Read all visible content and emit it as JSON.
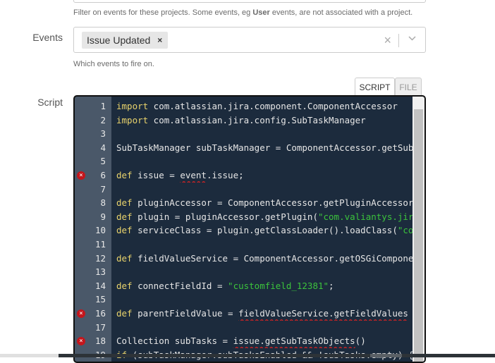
{
  "projects": {
    "help": "Filter on events for these projects. Some events, eg ",
    "help_bold": "User",
    "help_tail": " events, are not associated with a project."
  },
  "events": {
    "label": "Events",
    "selected": [
      {
        "label": "Issue Updated",
        "remove": "×"
      }
    ],
    "clear": "×",
    "chevron": "⌵",
    "help": "Which events to fire on."
  },
  "script": {
    "label": "Script",
    "tabs": [
      {
        "label": "SCRIPT",
        "active": true
      },
      {
        "label": "FILE",
        "active": false
      }
    ],
    "lines": [
      {
        "n": "1",
        "kw": "import",
        "rest": " com.atlassian.jira.component.ComponentAccessor"
      },
      {
        "n": "2",
        "kw": "import",
        "rest": " com.atlassian.jira.config.SubTaskManager"
      },
      {
        "n": "3",
        "rest": ""
      },
      {
        "n": "4",
        "rest": "SubTaskManager subTaskManager = ComponentAccessor.getSubTaskManager()"
      },
      {
        "n": "5",
        "rest": ""
      },
      {
        "n": "6",
        "kw": "def",
        "pre": " issue = ",
        "err": "event",
        "rest": ".issue;",
        "error": true
      },
      {
        "n": "7",
        "rest": ""
      },
      {
        "n": "8",
        "kw": "def",
        "rest": " pluginAccessor = ComponentAccessor.getPluginAccessor()"
      },
      {
        "n": "9",
        "kw": "def",
        "rest": " plugin = pluginAccessor.getPlugin(",
        "str": "\"com.valiantys.jira\""
      },
      {
        "n": "10",
        "kw": "def",
        "rest": " serviceClass = plugin.getClassLoader().loadClass(",
        "str": "\"com"
      },
      {
        "n": "11",
        "rest": ""
      },
      {
        "n": "12",
        "kw": "def",
        "rest": " fieldValueService = ComponentAccessor.getOSGiComponentInstanceOfType(serviceClass)"
      },
      {
        "n": "13",
        "rest": ""
      },
      {
        "n": "14",
        "kw": "def",
        "rest": " connectFieldId = ",
        "str": "\"customfield_12381\"",
        "tail": ";"
      },
      {
        "n": "15",
        "rest": ""
      },
      {
        "n": "16",
        "kw": "def",
        "pre": " parentFieldValue = ",
        "err": "fieldValueService.getFieldValues",
        "rest": "",
        "error": true
      },
      {
        "n": "17",
        "rest": ""
      },
      {
        "n": "18",
        "pre": "Collection subTasks = ",
        "err": "issue.getSubTaskObjects",
        "rest": "()",
        "error": true
      },
      {
        "n": "19",
        "kw": "if",
        "rest": " (subTaskManager.subTasksEnabled && !subTasks.empty) {"
      }
    ]
  }
}
